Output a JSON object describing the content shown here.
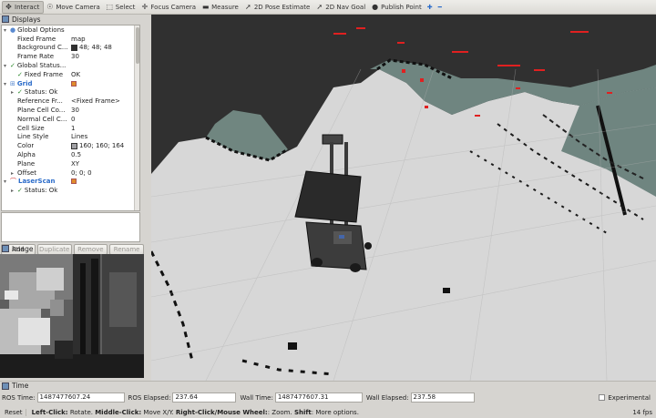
{
  "toolbar": {
    "tools": [
      {
        "label": "Interact",
        "icon": "interact-icon",
        "glyph": "✥",
        "active": true
      },
      {
        "label": "Move Camera",
        "icon": "move-camera-icon",
        "glyph": "☉"
      },
      {
        "label": "Select",
        "icon": "select-icon",
        "glyph": "⬚"
      },
      {
        "label": "Focus Camera",
        "icon": "focus-camera-icon",
        "glyph": "✛"
      },
      {
        "label": "Measure",
        "icon": "measure-icon",
        "glyph": "▬"
      },
      {
        "label": "2D Pose Estimate",
        "icon": "pose-estimate-icon",
        "glyph": "➚"
      },
      {
        "label": "2D Nav Goal",
        "icon": "nav-goal-icon",
        "glyph": "➚"
      },
      {
        "label": "Publish Point",
        "icon": "publish-point-icon",
        "glyph": "●"
      }
    ]
  },
  "displays": {
    "title": "Displays",
    "rows": [
      {
        "indent": 0,
        "arrow": "▾",
        "icon": "dot",
        "key": "Global Options",
        "val": ""
      },
      {
        "indent": 1,
        "key": "Fixed Frame",
        "val": "map"
      },
      {
        "indent": 1,
        "key": "Background C...",
        "val": "48; 48; 48",
        "swatch": "#303030"
      },
      {
        "indent": 1,
        "key": "Frame Rate",
        "val": "30"
      },
      {
        "indent": 0,
        "arrow": "▾",
        "check": true,
        "key": "Global Status...",
        "val": ""
      },
      {
        "indent": 1,
        "check": true,
        "key": "Fixed Frame",
        "val": "OK"
      },
      {
        "indent": 0,
        "arrow": "▾",
        "icon": "grid",
        "key": "Grid",
        "val": "",
        "blue": true,
        "box": true
      },
      {
        "indent": 1,
        "arrow": "▸",
        "check": true,
        "key": "Status: Ok",
        "val": ""
      },
      {
        "indent": 1,
        "key": "Reference Fr...",
        "val": "<Fixed Frame>"
      },
      {
        "indent": 1,
        "key": "Plane Cell Co...",
        "val": "30"
      },
      {
        "indent": 1,
        "key": "Normal Cell C...",
        "val": "0"
      },
      {
        "indent": 1,
        "key": "Cell Size",
        "val": "1"
      },
      {
        "indent": 1,
        "key": "Line Style",
        "val": "Lines"
      },
      {
        "indent": 1,
        "key": "Color",
        "val": "160; 160; 164",
        "swatch": "#a0a0a4"
      },
      {
        "indent": 1,
        "key": "Alpha",
        "val": "0.5"
      },
      {
        "indent": 1,
        "key": "Plane",
        "val": "XY"
      },
      {
        "indent": 1,
        "arrow": "▸",
        "key": "Offset",
        "val": "0; 0; 0"
      },
      {
        "indent": 0,
        "arrow": "▾",
        "icon": "laser",
        "key": "LaserScan",
        "val": "",
        "blue": true,
        "box": true
      },
      {
        "indent": 1,
        "arrow": "▸",
        "check": true,
        "key": "Status: Ok",
        "val": ""
      }
    ],
    "buttons": {
      "add": "Add",
      "duplicate": "Duplicate",
      "remove": "Remove",
      "rename": "Rename"
    }
  },
  "image_panel": {
    "title": "Image"
  },
  "time_panel": {
    "title": "Time",
    "ros_time_label": "ROS Time:",
    "ros_time": "1487477607.24",
    "ros_elapsed_label": "ROS Elapsed:",
    "ros_elapsed": "237.64",
    "wall_time_label": "Wall Time:",
    "wall_time": "1487477607.31",
    "wall_elapsed_label": "Wall Elapsed:",
    "wall_elapsed": "237.58",
    "experimental_label": "Experimental"
  },
  "status_bar": {
    "reset": "Reset",
    "hint_parts": [
      {
        "b": "Left-Click:",
        "t": " Rotate. "
      },
      {
        "b": "Middle-Click:",
        "t": " Move X/Y. "
      },
      {
        "b": "Right-Click/Mouse Wheel:",
        "t": ": Zoom. "
      },
      {
        "b": "Shift",
        "t": ": More options."
      }
    ],
    "fps": "14 fps"
  }
}
